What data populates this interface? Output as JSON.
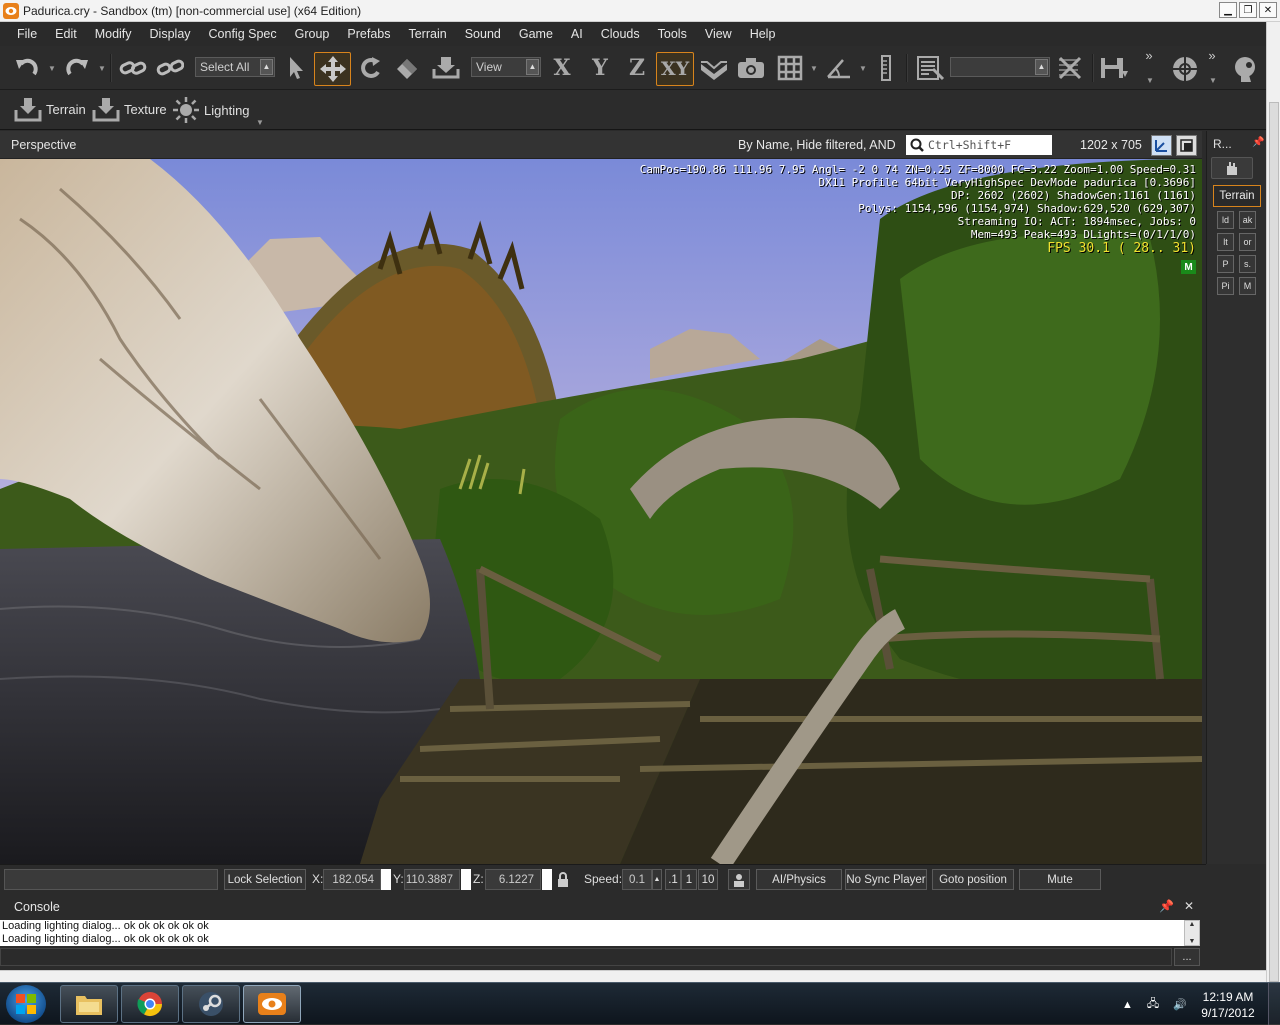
{
  "window": {
    "title": "Padurica.cry - Sandbox (tm) [non-commercial use] (x64 Edition)"
  },
  "menu": [
    "File",
    "Edit",
    "Modify",
    "Display",
    "Config Spec",
    "Group",
    "Prefabs",
    "Terrain",
    "Sound",
    "Game",
    "AI",
    "Clouds",
    "Tools",
    "View",
    "Help"
  ],
  "toolbar": {
    "select_filter": "Select All",
    "coord_system": "View",
    "axis_x": "X",
    "axis_y": "Y",
    "axis_z": "Z",
    "axis_xy": "XY",
    "more": "»"
  },
  "toolbar2": {
    "terrain": "Terrain",
    "texture": "Texture",
    "lighting": "Lighting"
  },
  "viewport": {
    "title": "Perspective",
    "filter_label": "By Name, Hide filtered, AND",
    "search_placeholder": "Ctrl+Shift+F",
    "resolution": "1202 x 705",
    "stats": [
      "CamPos=190.86 111.96 7.95 Angl= -2  0  74 ZN=0.25 ZF=8000 FC=3.22 Zoom=1.00 Speed=0.31",
      "DX11 Profile 64bit VeryHighSpec DevMode padurica [0.3696]",
      "DP: 2602 (2602) ShadowGen:1161 (1161)",
      "Polys: 1154,596 (1154,974) Shadow:629,520 (629,307)",
      "Streaming IO: ACT: 1894msec, Jobs: 0",
      "Mem=493 Peak=493 DLights=(0/1/1/0)"
    ],
    "fps": "FPS  30.1 ( 28.. 31)",
    "badge": "M"
  },
  "rollup": {
    "title": "R...",
    "tab": "Terrain",
    "buttons": [
      "ld",
      "ak",
      "lt",
      "or",
      "P",
      "s.",
      "Pi",
      "M"
    ]
  },
  "statusbar": {
    "lock_selection": "Lock Selection",
    "x_label": "X:",
    "x_value": "182.054",
    "y_label": "Y:",
    "y_value": "110.3887",
    "z_label": "Z:",
    "z_value": "6.1227",
    "speed_label": "Speed:",
    "speed_value": "0.1",
    "speed_presets": [
      ".1",
      "1",
      "10"
    ],
    "ai_physics": "AI/Physics",
    "sync_player": "No Sync Player",
    "goto_position": "Goto position",
    "mute": "Mute"
  },
  "console": {
    "title": "Console",
    "lines": [
      "Loading lighting dialog... ok ok ok ok ok ok",
      "Loading lighting dialog... ok ok ok ok ok ok"
    ],
    "more": "..."
  },
  "taskbar": {
    "time": "12:19 AM",
    "date": "9/17/2012"
  },
  "colors": {
    "accent": "#d8841c",
    "fps": "#f0e030",
    "badge": "#1a8a1a"
  }
}
